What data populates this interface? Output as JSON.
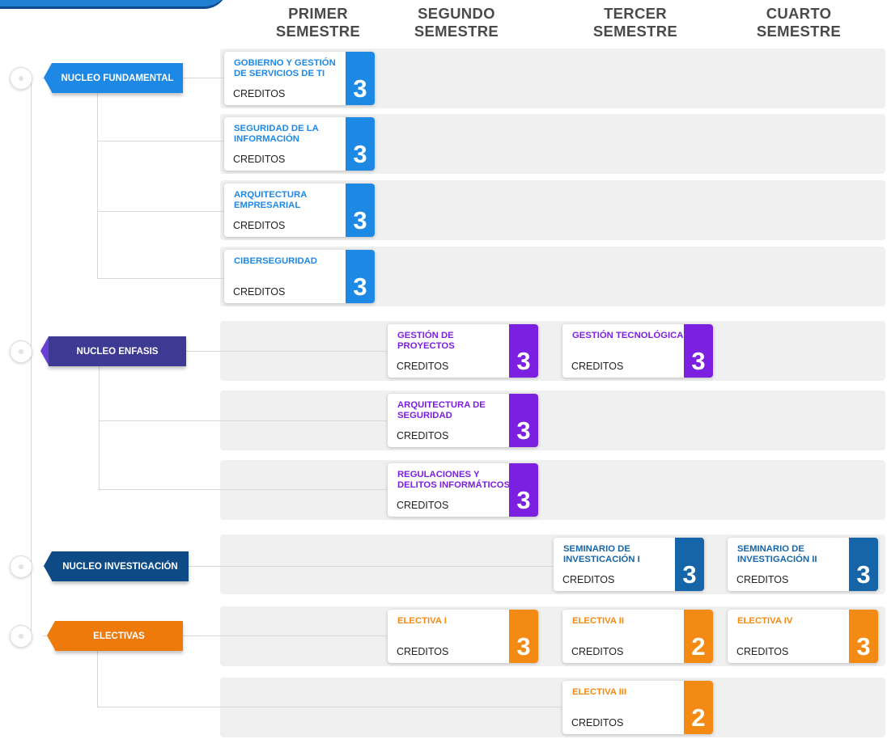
{
  "semesters": [
    {
      "line1": "PRIMER",
      "line2": "SEMESTRE"
    },
    {
      "line1": "SEGUNDO",
      "line2": "SEMESTRE"
    },
    {
      "line1": "TERCER",
      "line2": "SEMESTRE"
    },
    {
      "line1": "CUARTO",
      "line2": "SEMESTRE"
    }
  ],
  "colors": {
    "fundamental": "#1e88e5",
    "enfasis": "#7b1fe0",
    "investigacion": "#1565a8",
    "electivas": "#f28a14",
    "enfasis_label": "#3d3a93",
    "investigacion_label": "#0d4a86",
    "electivas_label": "#ee7a0c"
  },
  "groups": [
    {
      "label": "NUCLEO FUNDAMENTAL",
      "color_key": "fundamental"
    },
    {
      "label": "NUCLEO ENFASIS",
      "color_key": "enfasis_label"
    },
    {
      "label": "NUCLEO INVESTIGACIÓN",
      "color_key": "investigacion_label"
    },
    {
      "label": "ELECTIVAS",
      "color_key": "electivas_label"
    }
  ],
  "credits_label": "CREDITOS",
  "courses": [
    {
      "title": "GOBIERNO Y GESTIÓN DE SERVICIOS DE TI",
      "credits": "3",
      "semester": 1,
      "group": "fundamental"
    },
    {
      "title": "SEGURIDAD DE LA INFORMACIÓN",
      "credits": "3",
      "semester": 1,
      "group": "fundamental"
    },
    {
      "title": "ARQUITECTURA EMPRESARIAL",
      "credits": "3",
      "semester": 1,
      "group": "fundamental"
    },
    {
      "title": "CIBERSEGURIDAD",
      "credits": "3",
      "semester": 1,
      "group": "fundamental"
    },
    {
      "title": "GESTIÓN DE PROYECTOS",
      "credits": "3",
      "semester": 2,
      "group": "enfasis"
    },
    {
      "title": "GESTIÓN TECNOLÓGICA",
      "credits": "3",
      "semester": 3,
      "group": "enfasis"
    },
    {
      "title": "ARQUITECTURA DE SEGURIDAD",
      "credits": "3",
      "semester": 2,
      "group": "enfasis"
    },
    {
      "title": "REGULACIONES Y DELITOS INFORMÁTICOS",
      "credits": "3",
      "semester": 2,
      "group": "enfasis"
    },
    {
      "title": "SEMINARIO DE INVESTICACIÓN I",
      "credits": "3",
      "semester": 3,
      "group": "investigacion"
    },
    {
      "title": "SEMINARIO DE INVESTIGACIÓN II",
      "credits": "3",
      "semester": 4,
      "group": "investigacion"
    },
    {
      "title": "ELECTIVA I",
      "credits": "3",
      "semester": 2,
      "group": "electivas"
    },
    {
      "title": "ELECTIVA II",
      "credits": "2",
      "semester": 3,
      "group": "electivas"
    },
    {
      "title": "ELECTIVA IV",
      "credits": "3",
      "semester": 4,
      "group": "electivas"
    },
    {
      "title": "ELECTIVA III",
      "credits": "2",
      "semester": 3,
      "group": "electivas"
    }
  ]
}
